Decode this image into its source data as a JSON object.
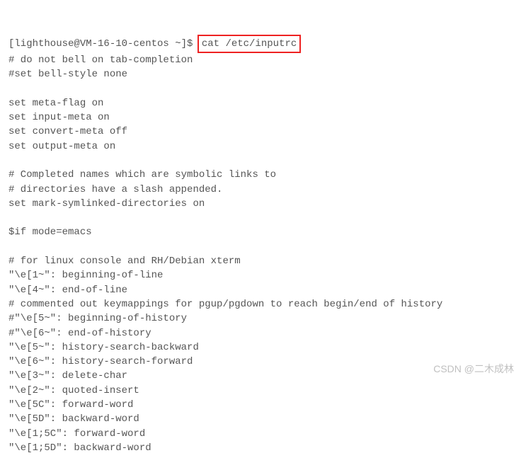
{
  "prompt": "[lighthouse@VM-16-10-centos ~]$ ",
  "command": "cat /etc/inputrc",
  "lines": [
    "# do not bell on tab-completion",
    "#set bell-style none",
    "",
    "set meta-flag on",
    "set input-meta on",
    "set convert-meta off",
    "set output-meta on",
    "",
    "# Completed names which are symbolic links to",
    "# directories have a slash appended.",
    "set mark-symlinked-directories on",
    "",
    "$if mode=emacs",
    "",
    "# for linux console and RH/Debian xterm",
    "\"\\e[1~\": beginning-of-line",
    "\"\\e[4~\": end-of-line",
    "# commented out keymappings for pgup/pgdown to reach begin/end of history",
    "#\"\\e[5~\": beginning-of-history",
    "#\"\\e[6~\": end-of-history",
    "\"\\e[5~\": history-search-backward",
    "\"\\e[6~\": history-search-forward",
    "\"\\e[3~\": delete-char",
    "\"\\e[2~\": quoted-insert",
    "\"\\e[5C\": forward-word",
    "\"\\e[5D\": backward-word",
    "\"\\e[1;5C\": forward-word",
    "\"\\e[1;5D\": backward-word"
  ],
  "watermark": "CSDN @二木成林"
}
